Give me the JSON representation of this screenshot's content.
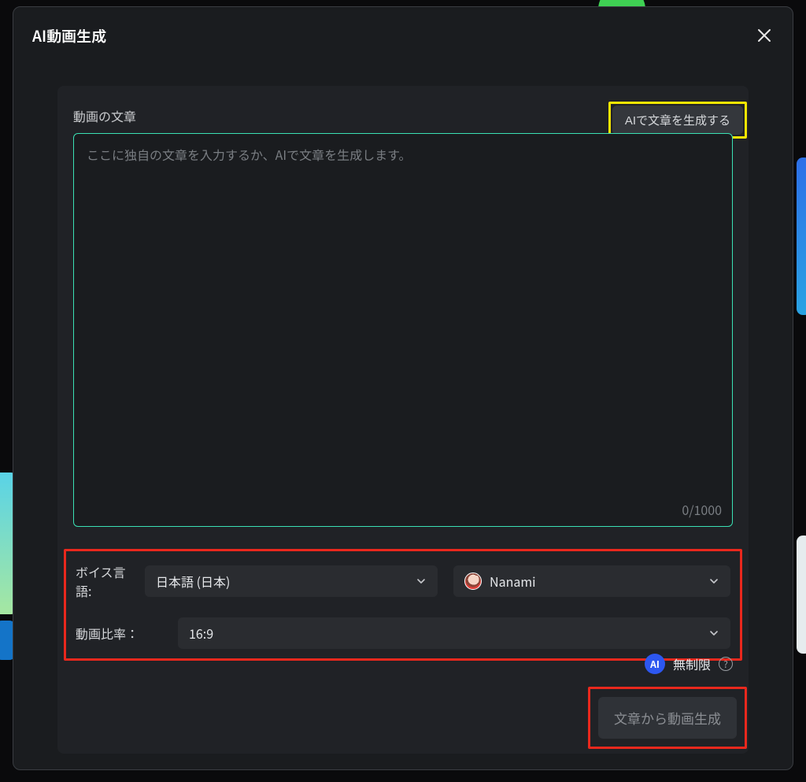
{
  "dialog": {
    "title": "AI動画生成"
  },
  "section": {
    "label": "動画の文章",
    "ai_button": "AIで文章を生成する",
    "textarea_placeholder": "ここに独自の文章を入力するか、AIで文章を生成します。",
    "counter": "0/1000"
  },
  "options": {
    "voice_language_label": "ボイス言語:",
    "voice_language_value": "日本語 (日本)",
    "voice_name": "Nanami",
    "aspect_label": "動画比率：",
    "aspect_value": "16:9"
  },
  "footer": {
    "ai_badge": "AI",
    "unlimited_label": "無制限",
    "generate_button": "文章から動画生成"
  }
}
